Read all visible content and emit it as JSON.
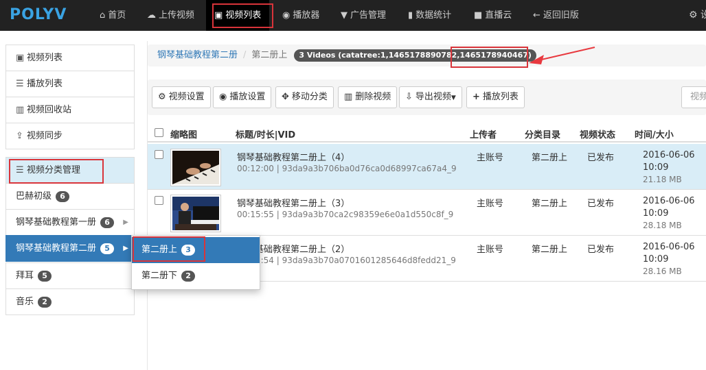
{
  "nav": {
    "logo": "POLYV",
    "items": [
      {
        "label": "首页",
        "icon": "home-icon"
      },
      {
        "label": "上传视频",
        "icon": "upload-icon"
      },
      {
        "label": "视频列表",
        "icon": "film-icon"
      },
      {
        "label": "播放器",
        "icon": "play-circle-icon"
      },
      {
        "label": "广告管理",
        "icon": "filter-icon"
      },
      {
        "label": "数据统计",
        "icon": "bar-chart-icon"
      },
      {
        "label": "直播云",
        "icon": "video-camera-icon"
      },
      {
        "label": "返回旧版",
        "icon": "arrow-left-icon"
      }
    ],
    "settings_label": "设"
  },
  "sidebar": {
    "items": [
      {
        "label": "视频列表",
        "icon": "film-icon"
      },
      {
        "label": "播放列表",
        "icon": "list-icon"
      },
      {
        "label": "视频回收站",
        "icon": "trash-icon"
      },
      {
        "label": "视频同步",
        "icon": "sync-icon"
      },
      {
        "label": "视频分类管理",
        "icon": "menu-icon"
      }
    ],
    "categories": [
      {
        "label": "巴赫初级",
        "count": "6"
      },
      {
        "label": "钢琴基础教程第一册",
        "count": "6"
      },
      {
        "label": "钢琴基础教程第二册",
        "count": "5"
      },
      {
        "label": "拜耳",
        "count": "5"
      },
      {
        "label": "音乐",
        "count": "2"
      }
    ],
    "submenu": [
      {
        "label": "第二册上",
        "count": "3"
      },
      {
        "label": "第二册下",
        "count": "2"
      }
    ]
  },
  "breadcrumb": {
    "parent": "钢琴基础教程第二册",
    "current": "第二册上",
    "badge": "3 Videos (catatree:1,1465178890782,1465178940467)"
  },
  "toolbar": {
    "video_settings": "视频设置",
    "player_settings": "播放设置",
    "move_category": "移动分类",
    "delete_video": "删除视频",
    "export_video": "导出视频",
    "playlist": "播放列表",
    "search_placeholder": "视频"
  },
  "table": {
    "headers": {
      "thumbnail": "缩略图",
      "title": "标题/时长|VID",
      "uploader": "上传者",
      "category": "分类目录",
      "status": "视频状态",
      "time_size": "时间/大小"
    },
    "rows": [
      {
        "title": "钢琴基础教程第二册上（4）",
        "meta": "00:12:00 | 93da9a3b706ba0d76ca0d68997ca67a4_9",
        "uploader": "主账号",
        "category": "第二册上",
        "status": "已发布",
        "date": "2016-06-06",
        "time": "10:09",
        "size": "21.18 MB"
      },
      {
        "title": "钢琴基础教程第二册上（3）",
        "meta": "00:15:55 | 93da9a3b70ca2c98359e6e0a1d550c8f_9",
        "uploader": "主账号",
        "category": "第二册上",
        "status": "已发布",
        "date": "2016-06-06",
        "time": "10:09",
        "size": "28.18 MB"
      },
      {
        "title": "钢琴基础教程第二册上（2）",
        "meta": "00:15:54 | 93da9a3b70a0701601285646d8fedd21_9",
        "uploader": "主账号",
        "category": "第二册上",
        "status": "已发布",
        "date": "2016-06-06",
        "time": "10:09",
        "size": "28.16 MB"
      }
    ]
  },
  "colors": {
    "nav_bg": "#222222",
    "primary": "#337ab7",
    "highlight_row": "#d9edf7",
    "annotation_red": "#d9343a"
  }
}
